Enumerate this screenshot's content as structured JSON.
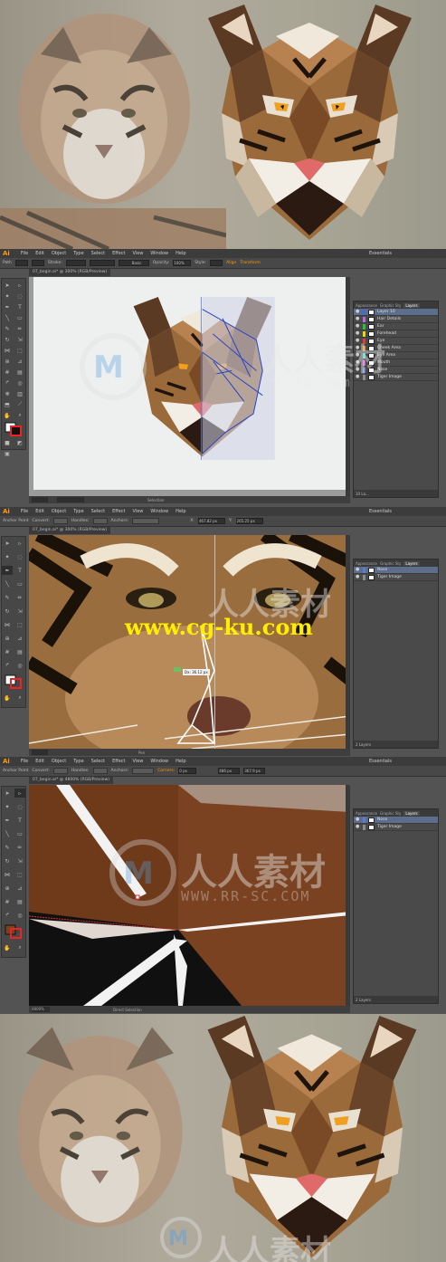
{
  "menus": [
    "File",
    "Edit",
    "Object",
    "Type",
    "Select",
    "Effect",
    "View",
    "Window",
    "Help"
  ],
  "app_logo": "Ai",
  "workspace_label": "Essentials",
  "screen1": {
    "ctrl_left": "Path",
    "stroke_label": "Stroke:",
    "style_preset": "Basic",
    "opacity_label": "Opacity:",
    "opacity_value": "100%",
    "style_label": "Style:",
    "align_label": "Align",
    "transform_label": "Transform",
    "doc_tab": "07_begin.ai* @ 300% (RGB/Preview)",
    "status_tool": "Selection",
    "layers_tabs": [
      "Appearance",
      "Graphic Sty",
      "Layers"
    ],
    "layers": [
      {
        "name": "Layer 10",
        "color": "#3e6fd8",
        "selected": true
      },
      {
        "name": "Hair Details",
        "color": "#b46adb"
      },
      {
        "name": "Ear",
        "color": "#28c33c"
      },
      {
        "name": "Forehead",
        "color": "#e0e000"
      },
      {
        "name": "Eye",
        "color": "#e03a3a"
      },
      {
        "name": "Cheek Area",
        "color": "#e58f1e"
      },
      {
        "name": "Eye Area",
        "color": "#3ad6d6"
      },
      {
        "name": "Mouth",
        "color": "#d65ad6"
      },
      {
        "name": "Nose",
        "color": "#5a7cd6"
      },
      {
        "name": "Tiger Image",
        "color": "#8a8a8a"
      }
    ],
    "layers_footer": "10 La..."
  },
  "screen2": {
    "ctrl_left": "Anchor Point",
    "convert_label": "Convert:",
    "handles_label": "Handles:",
    "anchors_label": "Anchors:",
    "x_label": "X:",
    "x_value": "467.82 px",
    "y_label": "Y:",
    "y_value": "265.25 px",
    "doc_tab": "07_begin.ai* @ 300% (RGB/Preview)",
    "status_tool": "Pen",
    "measure_tooltip": "Dx: 36.12 px",
    "layers_tabs": [
      "Appearance",
      "Graphic Sty",
      "Layers"
    ],
    "layers": [
      {
        "name": "Nose",
        "color": "#5a7cd6",
        "selected": true
      },
      {
        "name": "Tiger Image",
        "color": "#8a8a8a"
      }
    ],
    "layers_footer": "2 Layers"
  },
  "screen3": {
    "ctrl_left": "Anchor Point",
    "convert_label": "Convert:",
    "handles_label": "Handles:",
    "anchors_label": "Anchors:",
    "corners_label": "Corners:",
    "corners_value": "0 px",
    "x_value": "486 px",
    "y_value": "367.9 px",
    "doc_tab": "07_begin.ai* @ 4800% (RGB/Preview)",
    "zoom_value": "4800%",
    "status_tool": "Direct Selection",
    "layers_tabs": [
      "Appearance",
      "Graphic Sty",
      "Layers"
    ],
    "layers": [
      {
        "name": "Nose",
        "color": "#5a7cd6",
        "selected": true
      },
      {
        "name": "Tiger Image",
        "color": "#8a8a8a"
      }
    ],
    "layers_footer": "2 Layers"
  },
  "watermarks": {
    "cg_url": "www.cg-ku.com",
    "rr_logo": "人人素材",
    "rr_url": "WWW.RR-SC.COM",
    "rr_url2": "rr-sc.com"
  },
  "colors": {
    "ai_orange": "#ff9a00",
    "ui_dark": "#3c3c3c",
    "ui_mid": "#535353",
    "tiger_brown": "#8b5a2b",
    "canvas_brown": "#7a4220"
  }
}
